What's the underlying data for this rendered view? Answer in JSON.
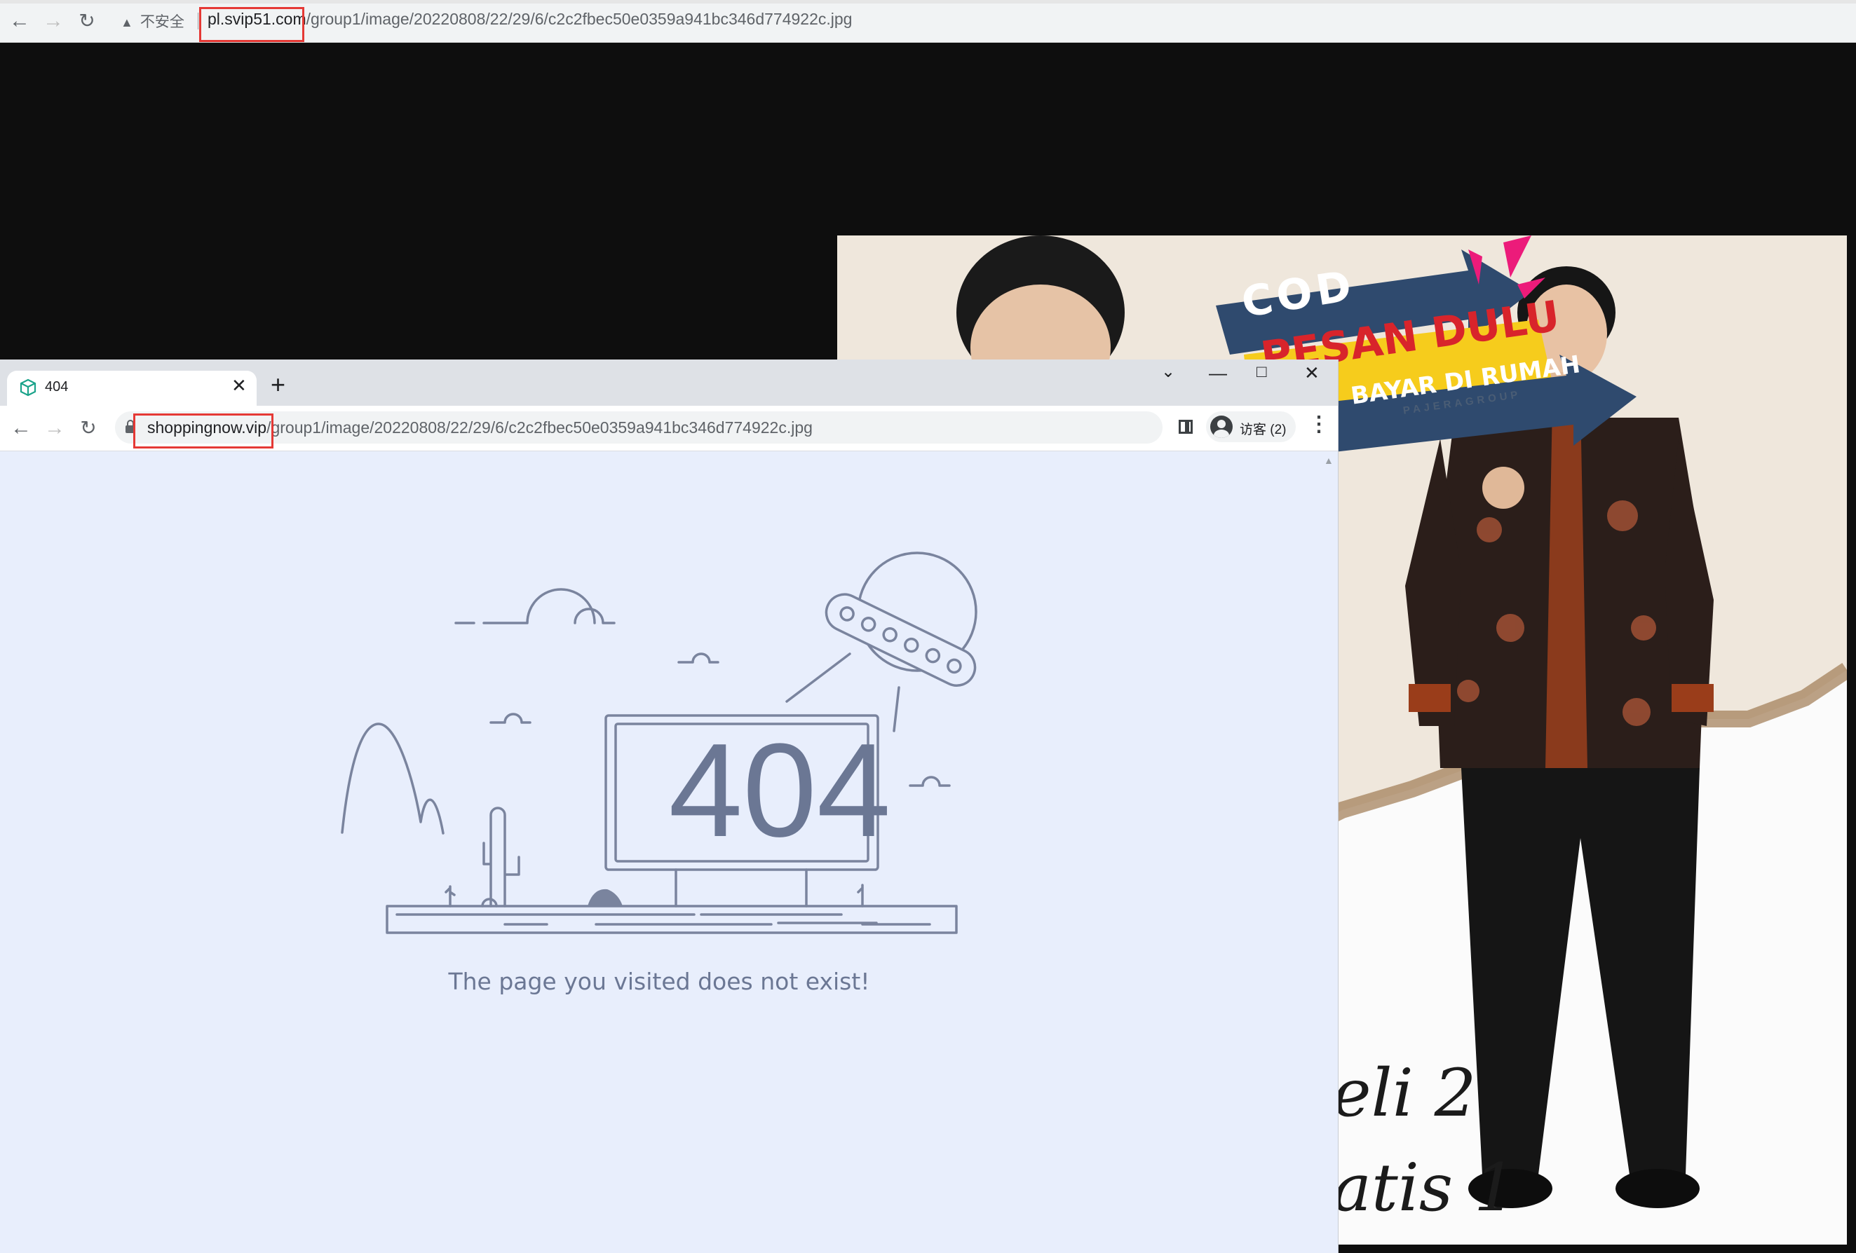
{
  "back_window": {
    "security_label": "不安全",
    "url_host": "pl.svip51.com",
    "url_path": "/group1/image/20220808/22/29/6/c2c2fbec50e0359a941bc346d774922c.jpg"
  },
  "product_image": {
    "banner_cod": "COD",
    "banner_pesan": "PESAN DULU",
    "banner_bayar": "BAYAR DI RUMAH",
    "banner_brand": "PAJERAGROUP",
    "script_line_1": "eli  2",
    "script_line_2": "atis  1"
  },
  "front_window": {
    "tab_title": "404",
    "url_host": "shoppingnow.vip",
    "url_path": "/group1/image/20220808/22/29/6/c2c2fbec50e0359a941bc346d774922c.jpg",
    "profile_label": "访客 (2)",
    "error_code": "404",
    "message": "The page you visited does not exist!"
  },
  "colors": {
    "highlight_box": "#e53935",
    "page_background": "#e8eefc",
    "illustration_stroke": "#7a849e"
  },
  "icons": [
    "back-arrow-icon",
    "forward-arrow-icon",
    "reload-icon",
    "warning-icon",
    "lock-icon",
    "close-icon",
    "plus-icon",
    "chevron-down-icon",
    "minimize-icon",
    "maximize-icon",
    "side-panel-icon",
    "avatar-icon",
    "kebab-menu-icon",
    "cube-favicon-icon"
  ]
}
